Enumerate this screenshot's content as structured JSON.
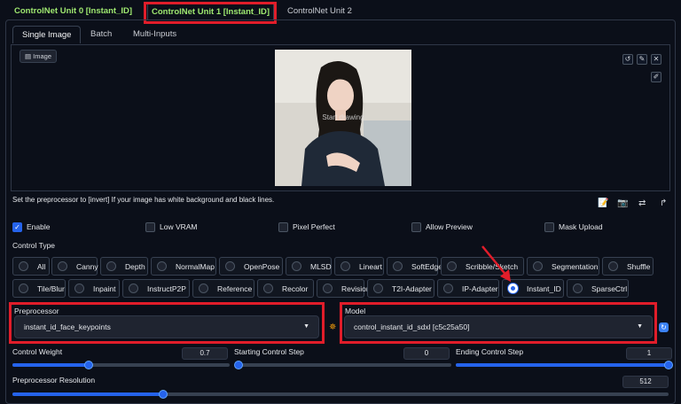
{
  "top_tabs": [
    {
      "label": "ControlNet Unit 0 [Instant_ID]"
    },
    {
      "label": "ControlNet Unit 1 [Instant_ID]"
    },
    {
      "label": "ControlNet Unit 2"
    }
  ],
  "sub_tabs": [
    {
      "label": "Single Image"
    },
    {
      "label": "Batch"
    },
    {
      "label": "Multi-Inputs"
    }
  ],
  "image": {
    "label": "Image",
    "overlay": "Start drawing"
  },
  "hint": "Set the preprocessor to [invert] If your image has white background and black lines.",
  "checkboxes": [
    {
      "label": "Enable",
      "checked": true
    },
    {
      "label": "Low VRAM",
      "checked": false
    },
    {
      "label": "Pixel Perfect",
      "checked": false
    },
    {
      "label": "Allow Preview",
      "checked": false
    },
    {
      "label": "Mask Upload",
      "checked": false
    }
  ],
  "control_type": {
    "label": "Control Type",
    "options": [
      "All",
      "Canny",
      "Depth",
      "NormalMap",
      "OpenPose",
      "MLSD",
      "Lineart",
      "SoftEdge",
      "Scribble/Sketch",
      "Segmentation",
      "Shuffle",
      "Tile/Blur",
      "Inpaint",
      "InstructP2P",
      "Reference",
      "Recolor",
      "Revision",
      "T2I-Adapter",
      "IP-Adapter",
      "Instant_ID",
      "SparseCtrl"
    ],
    "selected": "Instant_ID"
  },
  "preprocessor": {
    "label": "Preprocessor",
    "value": "instant_id_face_keypoints"
  },
  "model": {
    "label": "Model",
    "value": "control_instant_id_sdxl [c5c25a50]"
  },
  "sliders": {
    "control_weight": {
      "label": "Control Weight",
      "value": "0.7",
      "fraction": 0.35
    },
    "starting_step": {
      "label": "Starting Control Step",
      "value": "0",
      "fraction": 0.0
    },
    "ending_step": {
      "label": "Ending Control Step",
      "value": "1",
      "fraction": 1.0
    },
    "resolution": {
      "label": "Preprocessor Resolution",
      "value": "512",
      "fraction": 0.23
    }
  },
  "colors": {
    "accent": "#2563eb",
    "highlight": "#e11d2a",
    "unit_tab_text": "#9fe870"
  }
}
